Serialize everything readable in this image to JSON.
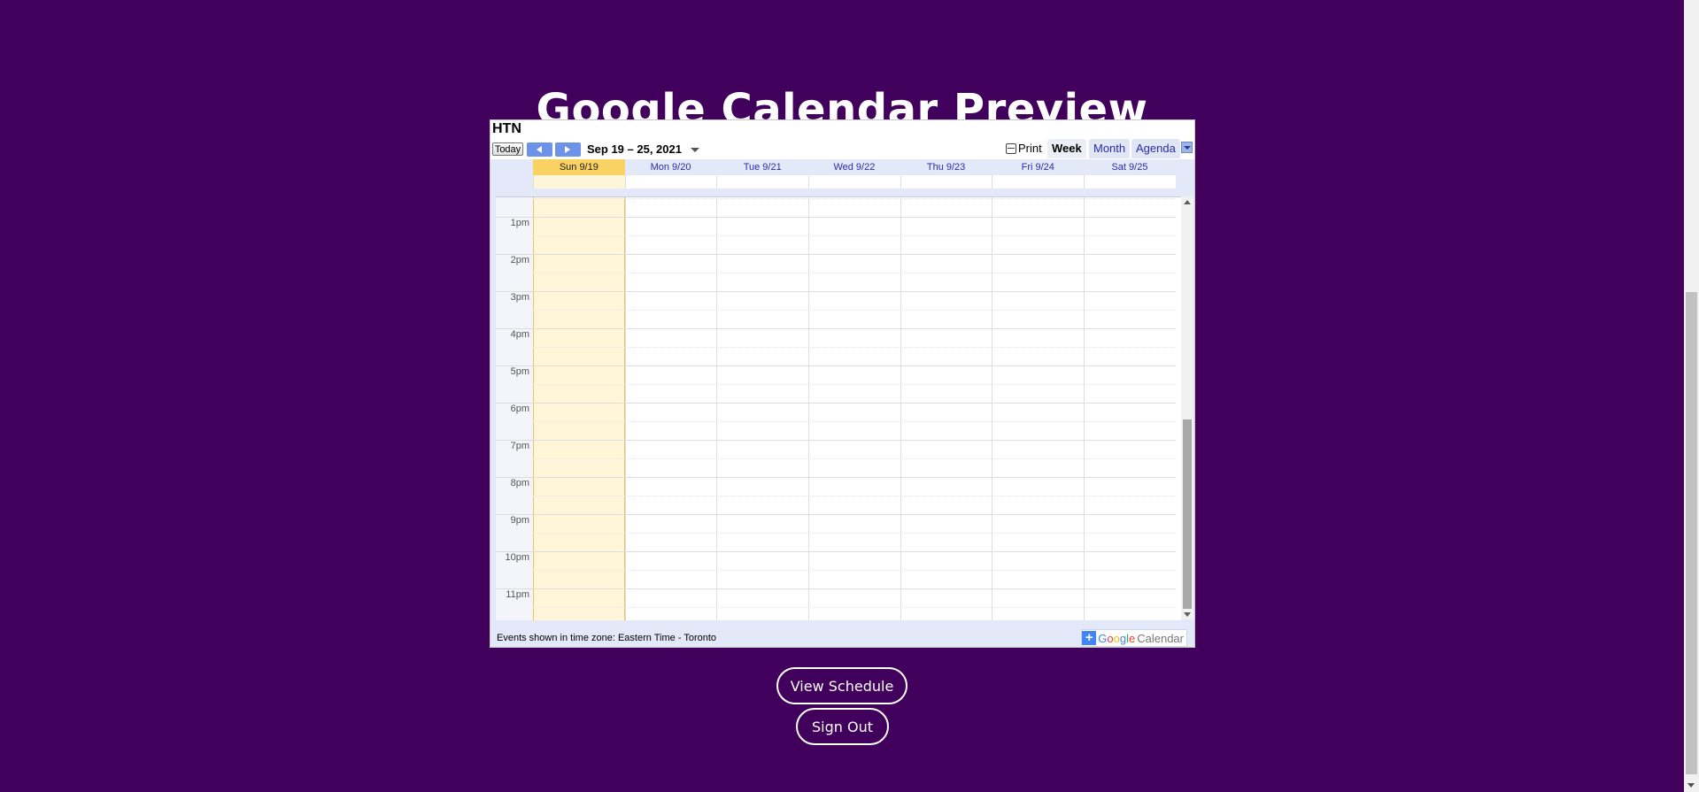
{
  "page": {
    "title": "Google Calendar Preview",
    "background": "#40005c"
  },
  "calendar": {
    "name": "HTN",
    "toolbar": {
      "today_label": "Today",
      "date_range": "Sep 19 – 25, 2021",
      "print_label": "Print",
      "views": {
        "week": "Week",
        "month": "Month",
        "agenda": "Agenda"
      },
      "active_view": "Week"
    },
    "days": [
      "Sun 9/19",
      "Mon 9/20",
      "Tue 9/21",
      "Wed 9/22",
      "Thu 9/23",
      "Fri 9/24",
      "Sat 9/25"
    ],
    "today_index": 0,
    "hours": [
      "1pm",
      "2pm",
      "3pm",
      "4pm",
      "5pm",
      "6pm",
      "7pm",
      "8pm",
      "9pm",
      "10pm",
      "11pm"
    ],
    "footer": {
      "timezone_text": "Events shown in time zone: Eastern Time - Toronto",
      "badge": {
        "g1": "G",
        "g2": "o",
        "g3": "o",
        "g4": "g",
        "g5": "l",
        "g6": "e",
        "word": "Calendar"
      }
    }
  },
  "actions": {
    "view_schedule": "View Schedule",
    "sign_out": "Sign Out"
  }
}
